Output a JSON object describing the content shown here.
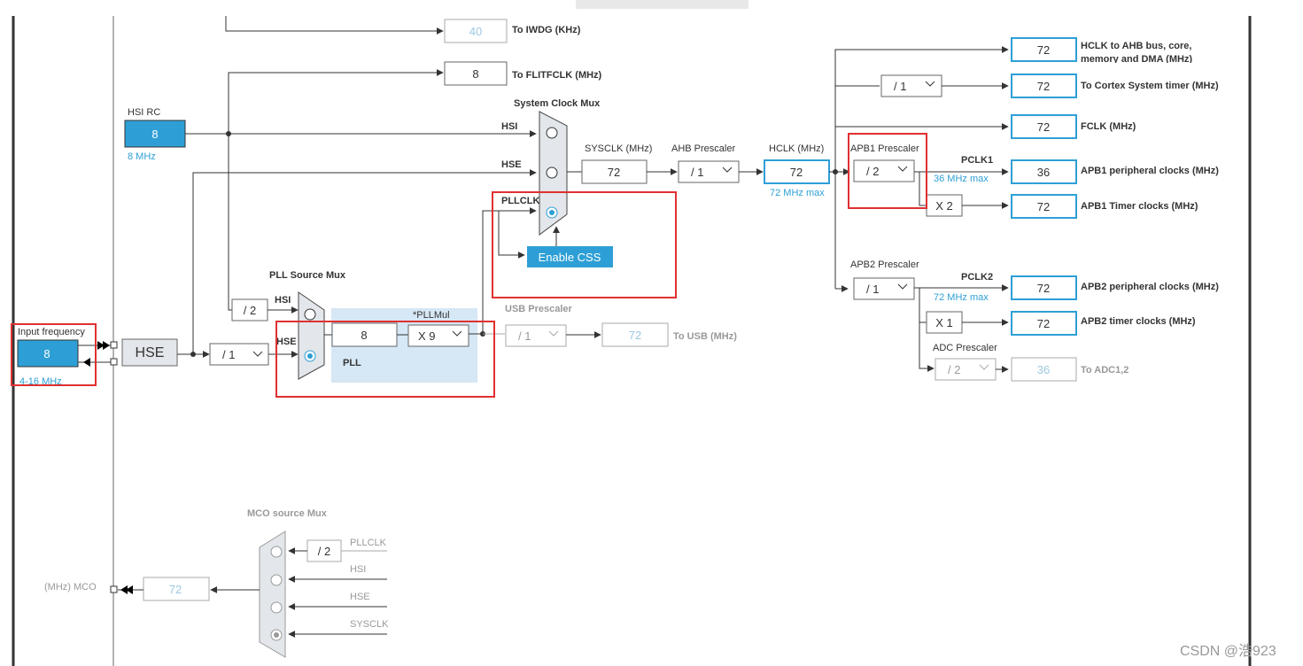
{
  "top": {
    "iwdg_value": "40",
    "iwdg_label": "To IWDG (KHz)",
    "flit_value": "8",
    "flit_label": "To FLITFCLK (MHz)"
  },
  "hsi_rc": {
    "label": "HSI RC",
    "value": "8",
    "freq": "8 MHz"
  },
  "input": {
    "label": "Input frequency",
    "value": "8",
    "range": "4-16 MHz",
    "hse_label": "HSE",
    "div_value": "/ 1"
  },
  "pll": {
    "mux_label": "PLL Source Mux",
    "div_value": "/ 2",
    "hsi_label": "HSI",
    "hse_label": "HSE",
    "input_value": "8",
    "mul_label": "*PLLMul",
    "mul_value": "X 9",
    "label": "PLL"
  },
  "sysmux": {
    "label": "System Clock Mux",
    "hsi": "HSI",
    "hse": "HSE",
    "pllclk": "PLLCLK",
    "css_button": "Enable CSS"
  },
  "sysclk": {
    "label": "SYSCLK (MHz)",
    "value": "72"
  },
  "ahb": {
    "label": "AHB Prescaler",
    "value": "/ 1"
  },
  "hclk": {
    "label": "HCLK (MHz)",
    "value": "72",
    "max": "72 MHz max"
  },
  "usb": {
    "label": "USB Prescaler",
    "div_value": "/ 1",
    "out_value": "72",
    "out_label": "To USB (MHz)"
  },
  "outputs": {
    "ahb_value": "72",
    "ahb_label_1": "HCLK to AHB bus, core,",
    "ahb_label_2": "memory and DMA (MHz)",
    "cortex_div": "/ 1",
    "cortex_value": "72",
    "cortex_label": "To Cortex System timer (MHz)",
    "fclk_value": "72",
    "fclk_label": "FCLK (MHz)"
  },
  "apb1": {
    "label": "APB1 Prescaler",
    "value": "/ 2",
    "pclk": "PCLK1",
    "max": "36 MHz max",
    "periph_value": "36",
    "periph_label": "APB1 peripheral clocks (MHz)",
    "mult": "X 2",
    "timer_value": "72",
    "timer_label": "APB1 Timer clocks (MHz)"
  },
  "apb2": {
    "label": "APB2 Prescaler",
    "value": "/ 1",
    "pclk": "PCLK2",
    "max": "72 MHz max",
    "periph_value": "72",
    "periph_label": "APB2 peripheral clocks (MHz)",
    "mult": "X 1",
    "timer_value": "72",
    "timer_label": "APB2 timer clocks (MHz)"
  },
  "adc": {
    "label": "ADC Prescaler",
    "value": "/ 2",
    "out_value": "36",
    "out_label": "To ADC1,2"
  },
  "mco": {
    "label": "MCO source Mux",
    "div_value": "/ 2",
    "pllclk": "PLLCLK",
    "hsi": "HSI",
    "hse": "HSE",
    "sysclk": "SYSCLK",
    "out_label": "(MHz) MCO",
    "out_value": "72"
  },
  "watermark": "CSDN @浩923",
  "colors": {
    "accent": "#2e9fd6",
    "highlight": "#e03030",
    "pll_panel": "#d6e7f5"
  }
}
